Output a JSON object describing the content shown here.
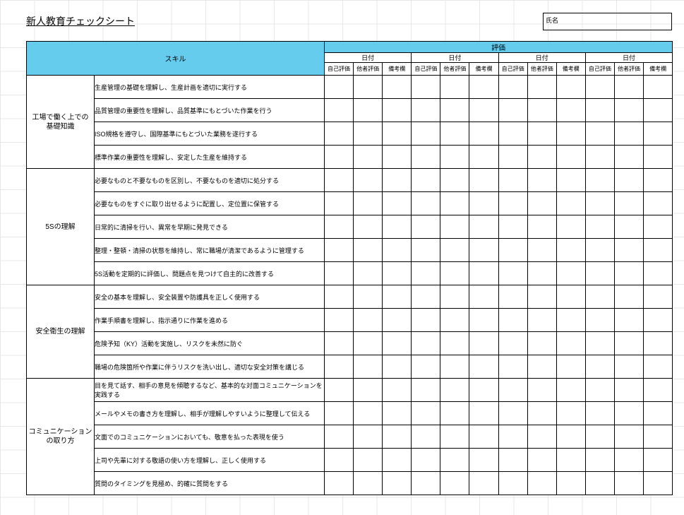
{
  "title": "新人教育チェックシート",
  "name_label": "氏名",
  "headers": {
    "skill": "スキル",
    "evaluation": "評価",
    "date": "日付",
    "sub": {
      "self": "自己評価",
      "other": "他者評価",
      "remark": "備考欄"
    }
  },
  "date_blocks": 4,
  "categories": [
    {
      "name": "工場で働く上での\n基礎知識",
      "skills": [
        "生産管理の基礎を理解し、生産計画を適切に実行する",
        "品質管理の重要性を理解し、品質基準にもとづいた作業を行う",
        "ISO規格を遵守し、国際基準にもとづいた業務を遂行する",
        "標準作業の重要性を理解し、安定した生産を維持する"
      ]
    },
    {
      "name": "5Sの理解",
      "skills": [
        "必要なものと不要なものを区別し、不要なものを適切に処分する",
        "必要なものをすぐに取り出せるように配置し、定位置に保管する",
        "日常的に清掃を行い、異常を早期に発見できる",
        "整理・整頓・清掃の状態を維持し、常に職場が清潔であるように管理する",
        "5S活動を定期的に評価し、問題点を見つけて自主的に改善する"
      ]
    },
    {
      "name": "安全衛生の理解",
      "skills": [
        "安全の基本を理解し、安全装置や防護具を正しく使用する",
        "作業手順書を理解し、指示通りに作業を進める",
        "危険予知（KY）活動を実施し、リスクを未然に防ぐ",
        "職場の危険箇所や作業に伴うリスクを洗い出し、適切な安全対策を講じる"
      ]
    },
    {
      "name": "コミュニケーション\nの取り方",
      "skills": [
        "目を見て話す、相手の意見を傾聴するなど、基本的な対面コミュニケーションを実践する",
        "メールやメモの書き方を理解し、相手が理解しやすいように整理して伝える",
        "文面でのコミュニケーションにおいても、敬意を払った表現を使う",
        "上司や先輩に対する敬語の使い方を理解し、正しく使用する",
        "質問のタイミングを見極め、的確に質問をする"
      ]
    }
  ]
}
